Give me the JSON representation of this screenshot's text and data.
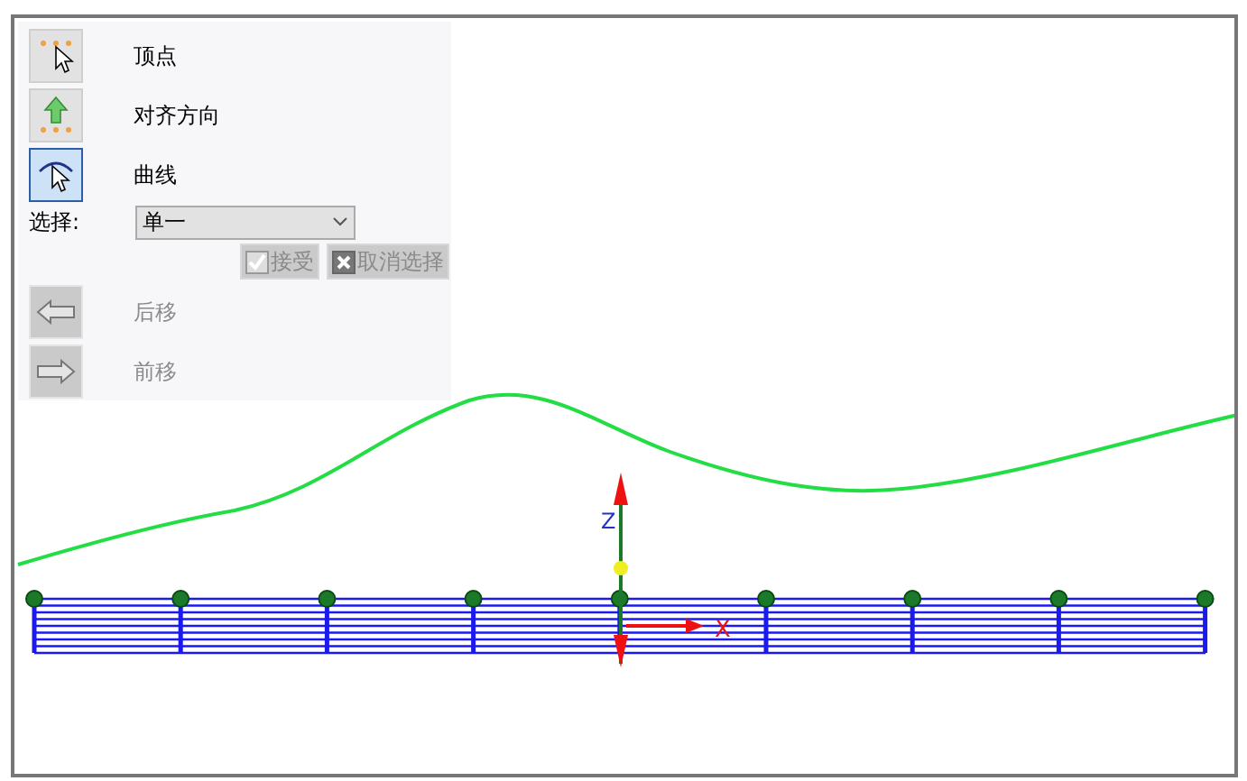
{
  "panel": {
    "options": [
      {
        "kind": "vertex",
        "label": "顶点",
        "selected": false
      },
      {
        "kind": "align",
        "label": "对齐方向",
        "selected": false
      },
      {
        "kind": "curve",
        "label": "曲线",
        "selected": true
      }
    ],
    "select": {
      "label": "选择:",
      "value": "单一"
    },
    "buttons": [
      {
        "kind": "accept",
        "label": "接受",
        "disabled": true
      },
      {
        "kind": "cancel",
        "label": "取消选择",
        "disabled": true
      }
    ],
    "nav": [
      {
        "kind": "back",
        "label": "后移",
        "disabled": true
      },
      {
        "kind": "forward",
        "label": "前移",
        "disabled": true
      }
    ]
  },
  "viewport": {
    "axes": {
      "z_label": "Z",
      "x_label": "X"
    }
  }
}
